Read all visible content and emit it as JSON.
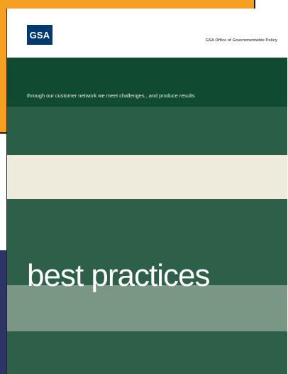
{
  "header": {
    "logo_text": "GSA",
    "office": "GSA Office of Governmentwide Policy"
  },
  "cover": {
    "tagline": "through our customer network we meet challenges...and produce results",
    "title": "best practices"
  },
  "colors": {
    "orange": "#f5a023",
    "navy": "#2e3466",
    "dark_green": "#104a30",
    "green": "#2d5f49",
    "cream": "#eeebdd",
    "sage": "#7a9684",
    "gsa_blue": "#003a70"
  }
}
